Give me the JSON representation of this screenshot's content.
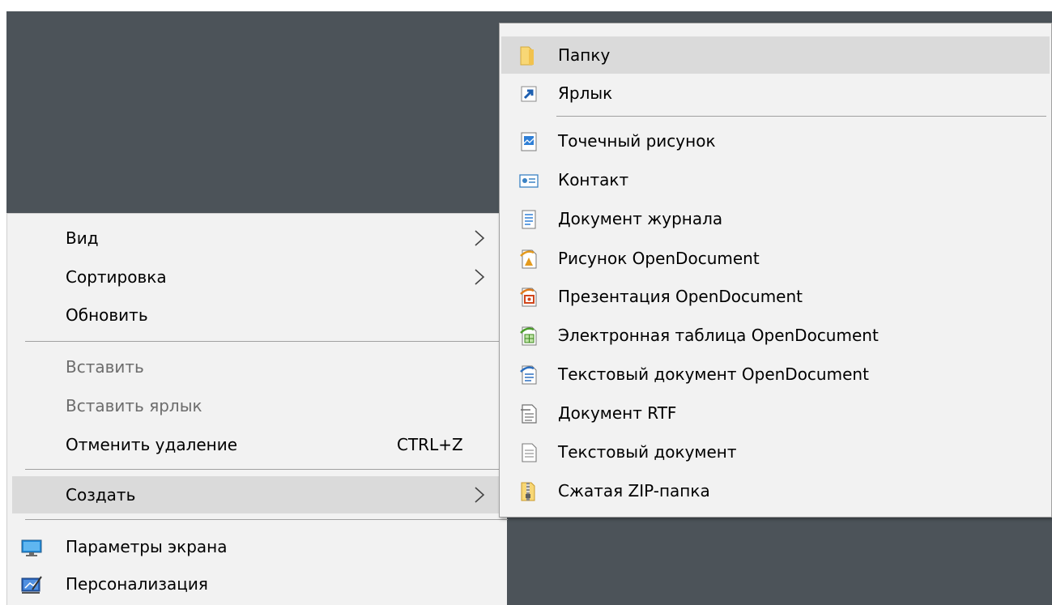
{
  "main_menu": {
    "view": "Вид",
    "sort": "Сортировка",
    "refresh": "Обновить",
    "paste": "Вставить",
    "paste_shortcut": "Вставить ярлык",
    "undo_delete": "Отменить удаление",
    "undo_delete_key": "CTRL+Z",
    "new": "Создать",
    "display_settings": "Параметры экрана",
    "personalize": "Персонализация"
  },
  "sub_menu": {
    "folder": "Папку",
    "shortcut": "Ярлык",
    "bitmap": "Точечный рисунок",
    "contact": "Контакт",
    "journal": "Документ журнала",
    "od_drawing": "Рисунок OpenDocument",
    "od_presentation": "Презентация OpenDocument",
    "od_spreadsheet": "Электронная таблица OpenDocument",
    "od_text": "Текстовый документ OpenDocument",
    "rtf": "Документ RTF",
    "text": "Текстовый документ",
    "zip": "Сжатая ZIP-папка"
  },
  "colors": {
    "desktop": "#4c5359",
    "menu_bg": "#f2f2f2",
    "hover_bg": "#dadada",
    "disabled_text": "#6d6d6d"
  },
  "icons": {
    "folder": "folder-icon",
    "shortcut": "shortcut-icon",
    "bitmap": "bitmap-image-icon",
    "contact": "contact-card-icon",
    "journal": "journal-document-icon",
    "od_drawing": "opendocument-drawing-icon",
    "od_presentation": "opendocument-presentation-icon",
    "od_spreadsheet": "opendocument-spreadsheet-icon",
    "od_text": "opendocument-text-icon",
    "rtf": "rtf-document-icon",
    "text": "text-document-icon",
    "zip": "zip-folder-icon",
    "display_settings": "monitor-icon",
    "personalize": "personalization-icon"
  }
}
